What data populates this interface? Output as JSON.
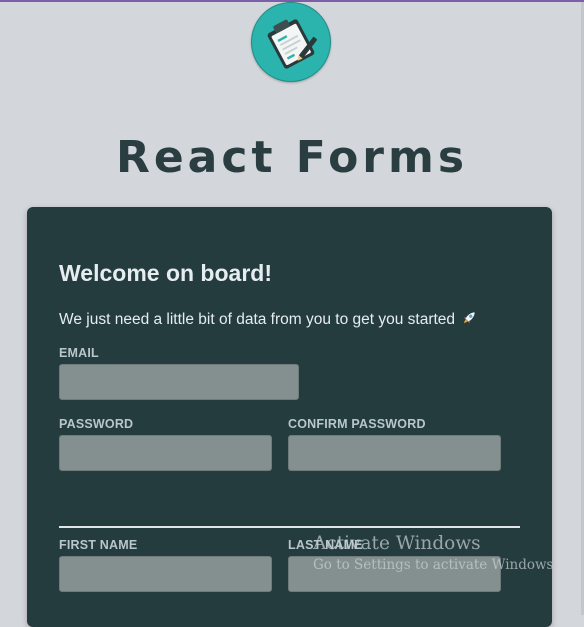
{
  "app": {
    "title": "React Forms",
    "logo_icon": "clipboard-form-icon",
    "accent_color": "#2bb3ad"
  },
  "form": {
    "heading": "Welcome on board!",
    "intro": "We just need a little bit of data from you to get you started",
    "intro_icon": "rocket-icon",
    "fields": {
      "email": {
        "label": "EMAIL",
        "value": "",
        "placeholder": ""
      },
      "password": {
        "label": "PASSWORD",
        "value": "",
        "placeholder": ""
      },
      "confirm_password": {
        "label": "CONFIRM PASSWORD",
        "value": "",
        "placeholder": ""
      },
      "first_name": {
        "label": "FIRST NAME",
        "value": "",
        "placeholder": ""
      },
      "last_name": {
        "label": "LAST NAME",
        "value": "",
        "placeholder": ""
      }
    }
  },
  "watermark": {
    "title": "Activate Windows",
    "subtitle": "Go to Settings to activate Windows."
  },
  "colors": {
    "page_background": "#d3d6db",
    "card_background": "#243c3e",
    "input_background": "#848f90",
    "title_color": "#2a3d41",
    "top_accent": "#7d5ea8"
  }
}
